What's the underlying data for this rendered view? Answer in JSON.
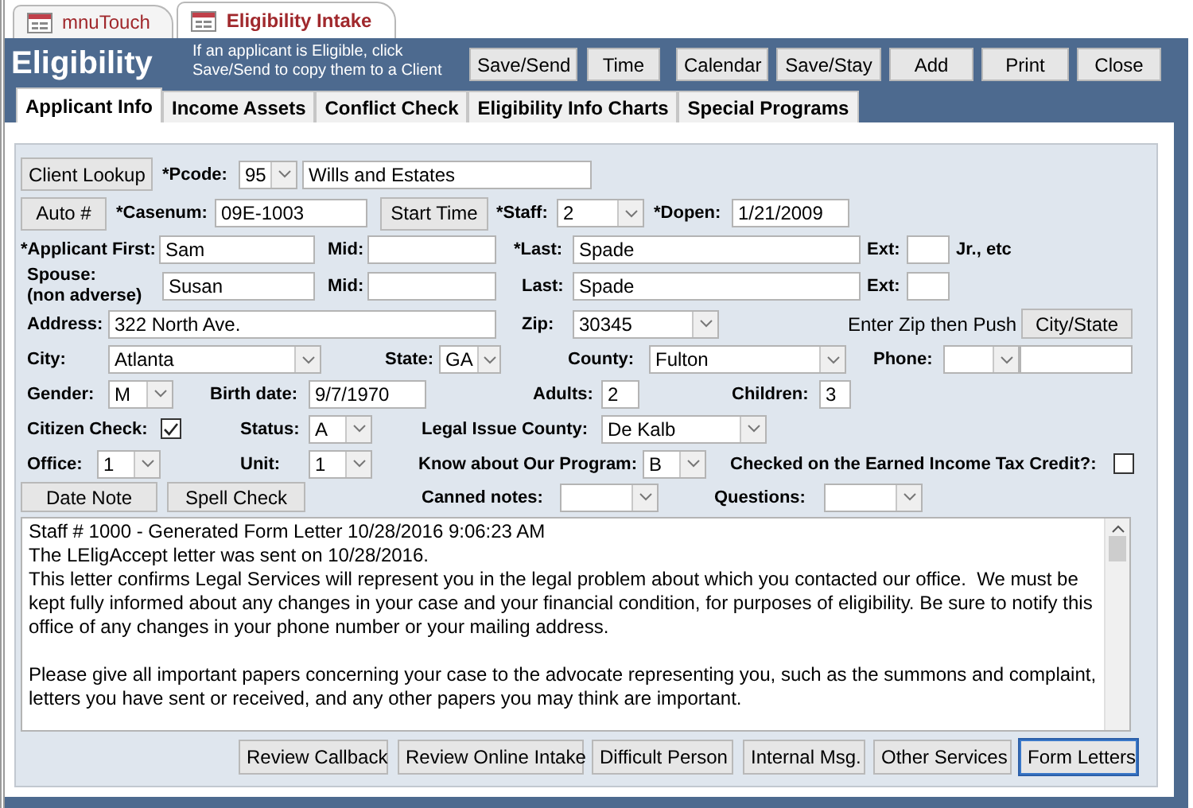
{
  "doc_tabs": [
    {
      "label": "mnuTouch",
      "selected": false
    },
    {
      "label": "Eligibility Intake",
      "selected": true
    }
  ],
  "header": {
    "title": "Eligibility",
    "hint": "If an applicant is Eligible, click Save/Send to copy them to a Client"
  },
  "toolbar": [
    "Save/Send",
    "Time",
    "Calendar",
    "Save/Stay",
    "Add",
    "Print",
    "Close"
  ],
  "tabs": [
    {
      "label": "Applicant Info",
      "selected": true
    },
    {
      "label": "Income Assets",
      "selected": false
    },
    {
      "label": "Conflict Check",
      "selected": false
    },
    {
      "label": "Eligibility Info Charts",
      "selected": false
    },
    {
      "label": "Special Programs",
      "selected": false
    }
  ],
  "form_rows": [
    [
      {
        "kind": "button",
        "label": "Client Lookup"
      },
      {
        "kind": "label",
        "text": "*Pcode:"
      },
      {
        "kind": "combo",
        "value": "95"
      },
      {
        "kind": "field",
        "value": "Wills and Estates"
      }
    ],
    [
      {
        "kind": "button",
        "label": "Auto #"
      },
      {
        "kind": "label",
        "text": "*Casenum:"
      },
      {
        "kind": "field",
        "value": "09E-1003"
      },
      {
        "kind": "button",
        "label": "Start Time"
      },
      {
        "kind": "label",
        "text": "*Staff:"
      },
      {
        "kind": "combo",
        "value": "2"
      },
      {
        "kind": "label",
        "text": "*Dopen:"
      },
      {
        "kind": "field",
        "value": "1/21/2009"
      }
    ],
    [
      {
        "kind": "label",
        "text": "*Applicant First:"
      },
      {
        "kind": "field",
        "value": "Sam"
      },
      {
        "kind": "label",
        "text": "Mid:"
      },
      {
        "kind": "field"
      },
      {
        "kind": "label",
        "text": "*Last:"
      },
      {
        "kind": "field",
        "value": "Spade"
      },
      {
        "kind": "label",
        "text": "Ext:"
      },
      {
        "kind": "field"
      },
      {
        "kind": "label",
        "text": "Jr., etc"
      }
    ],
    [
      {
        "kind": "stack",
        "lines": [
          "Spouse:",
          "(non adverse)"
        ]
      },
      {
        "kind": "field",
        "value": "Susan"
      },
      {
        "kind": "label",
        "text": "Mid:"
      },
      {
        "kind": "field"
      },
      {
        "kind": "label",
        "text": "Last:"
      },
      {
        "kind": "field",
        "value": "Spade"
      },
      {
        "kind": "label",
        "text": "Ext:"
      },
      {
        "kind": "field"
      }
    ],
    [
      {
        "kind": "label",
        "text": "Address:"
      },
      {
        "kind": "field",
        "value": "322 North Ave."
      },
      {
        "kind": "label",
        "text": "Zip:"
      },
      {
        "kind": "combo",
        "value": "30345"
      },
      {
        "kind": "note",
        "text": "Enter Zip then Push"
      },
      {
        "kind": "button",
        "label": "City/State"
      }
    ],
    [
      {
        "kind": "label",
        "text": "City:"
      },
      {
        "kind": "combo",
        "value": "Atlanta"
      },
      {
        "kind": "label",
        "text": "State:"
      },
      {
        "kind": "combo",
        "value": "GA"
      },
      {
        "kind": "label",
        "text": "County:"
      },
      {
        "kind": "combo",
        "value": "Fulton"
      },
      {
        "kind": "label",
        "text": "Phone:"
      },
      {
        "kind": "combo"
      },
      {
        "kind": "field"
      }
    ],
    [
      {
        "kind": "label",
        "text": "Gender:"
      },
      {
        "kind": "combo",
        "value": "M"
      },
      {
        "kind": "label",
        "text": "Birth date:"
      },
      {
        "kind": "field",
        "value": "9/7/1970"
      },
      {
        "kind": "label",
        "text": "Adults:"
      },
      {
        "kind": "field",
        "value": "2"
      },
      {
        "kind": "label",
        "text": "Children:"
      },
      {
        "kind": "field",
        "value": "3"
      }
    ],
    [
      {
        "kind": "label",
        "text": "Citizen Check:"
      },
      {
        "kind": "checkbox",
        "checked": true
      },
      {
        "kind": "label",
        "text": "Status:"
      },
      {
        "kind": "combo",
        "value": "A"
      },
      {
        "kind": "label",
        "text": "Legal Issue County:"
      },
      {
        "kind": "combo",
        "value": "De Kalb"
      }
    ],
    [
      {
        "kind": "label",
        "text": "Office:"
      },
      {
        "kind": "combo",
        "value": "1"
      },
      {
        "kind": "label",
        "text": "Unit:"
      },
      {
        "kind": "combo",
        "value": "1"
      },
      {
        "kind": "label",
        "text": "Know about Our Program:"
      },
      {
        "kind": "combo",
        "value": "B"
      },
      {
        "kind": "label",
        "text": "Checked on the Earned Income Tax Credit?:"
      },
      {
        "kind": "checkbox",
        "checked": false
      }
    ],
    [
      {
        "kind": "button",
        "label": "Date Note"
      },
      {
        "kind": "button",
        "label": "Spell Check"
      },
      {
        "kind": "label",
        "text": "Canned notes:"
      },
      {
        "kind": "combo"
      },
      {
        "kind": "label",
        "text": "Questions:"
      },
      {
        "kind": "combo"
      }
    ]
  ],
  "notes": "Staff # 1000 - Generated Form Letter 10/28/2016 9:06:23 AM\nThe LEligAccept letter was sent on 10/28/2016.\nThis letter confirms Legal Services will represent you in the legal problem about which you contacted our office.  We must be kept fully informed about any changes in your case and your financial condition, for purposes of eligibility. Be sure to notify this office of any changes in your phone number or your mailing address.\n\nPlease give all important papers concerning your case to the advocate representing you, such as the summons and complaint, letters you have sent or received, and any other papers you may think are important.",
  "bottom_buttons": [
    {
      "label": "Review Callback",
      "focused": false
    },
    {
      "label": "Review Online Intake",
      "focused": false
    },
    {
      "label": "Difficult Person",
      "focused": false
    },
    {
      "label": "Internal Msg.",
      "focused": false
    },
    {
      "label": "Other Services",
      "focused": false
    },
    {
      "label": "Form Letters",
      "focused": true
    }
  ]
}
